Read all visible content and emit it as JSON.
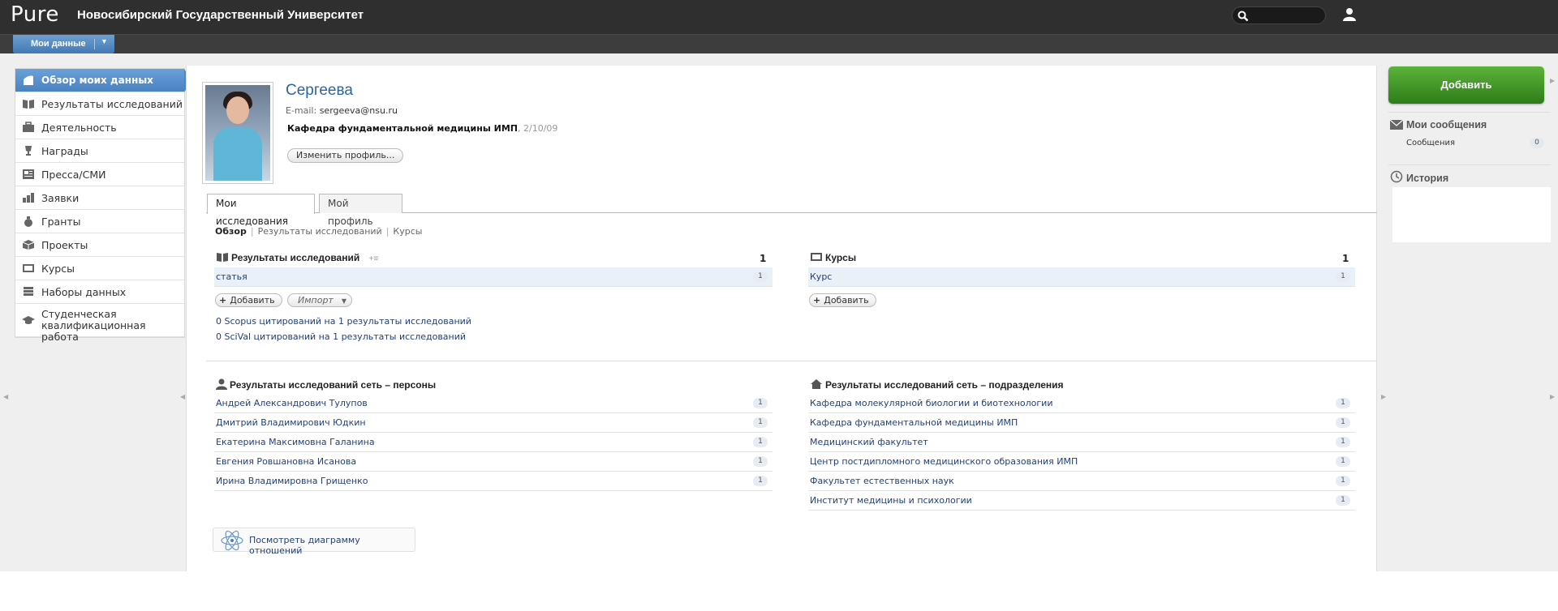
{
  "header": {
    "logo": "Pure",
    "university": "Новосибирский Государственный Университет"
  },
  "subbar": {
    "my_data_label": "Мои данные"
  },
  "nav": {
    "items": [
      {
        "label": "Обзор моих данных"
      },
      {
        "label": "Результаты исследований"
      },
      {
        "label": "Деятельность"
      },
      {
        "label": "Награды"
      },
      {
        "label": "Пресса/СМИ"
      },
      {
        "label": "Заявки"
      },
      {
        "label": "Гранты"
      },
      {
        "label": "Проекты"
      },
      {
        "label": "Курсы"
      },
      {
        "label": "Наборы данных"
      },
      {
        "label": "Студенческая квалификационная работа"
      }
    ]
  },
  "profile": {
    "name": "Сергеева",
    "email_label": "E-mail:",
    "email": "sergeeva@nsu.ru",
    "department": "Кафедра фундаментальной медицины ИМП",
    "date": ", 2/10/09",
    "edit_button": "Изменить профиль..."
  },
  "tabs": [
    {
      "label": "Мои исследования"
    },
    {
      "label": "Мой профиль"
    }
  ],
  "subnav": {
    "overview": "Обзор",
    "results": "Результаты исследований",
    "courses": "Курсы"
  },
  "research": {
    "title": "Результаты исследований",
    "count": "1",
    "rows": [
      {
        "label": "статья",
        "count": "1"
      }
    ],
    "add": "Добавить",
    "import": "Импорт",
    "scopus": "0 Scopus цитирований на 1 результаты исследований",
    "scival": "0 SciVal цитирований на 1 результаты исследований"
  },
  "courses": {
    "title": "Курсы",
    "count": "1",
    "rows": [
      {
        "label": "Курс",
        "count": "1"
      }
    ],
    "add": "Добавить"
  },
  "network_persons": {
    "title": "Результаты исследований сеть – персоны",
    "rows": [
      {
        "label": "Андрей Александрович Тулупов",
        "count": "1"
      },
      {
        "label": "Дмитрий Владимирович Юдкин",
        "count": "1"
      },
      {
        "label": "Екатерина Максимовна Галанина",
        "count": "1"
      },
      {
        "label": "Евгения Ровшановна Исанова",
        "count": "1"
      },
      {
        "label": "Ирина Владимировна Грищенко",
        "count": "1"
      }
    ]
  },
  "network_units": {
    "title": "Результаты исследований сеть – подразделения",
    "rows": [
      {
        "label": "Кафедра молекулярной биологии и биотехнологии",
        "count": "1"
      },
      {
        "label": "Кафедра фундаментальной медицины ИМП",
        "count": "1"
      },
      {
        "label": "Медицинский факультет",
        "count": "1"
      },
      {
        "label": "Центр постдипломного медицинского образования ИМП",
        "count": "1"
      },
      {
        "label": "Факультет естественных наук",
        "count": "1"
      },
      {
        "label": "Институт медицины и психологии",
        "count": "1"
      }
    ]
  },
  "graph_button": "Посмотреть диаграмму отношений",
  "right": {
    "add_button": "Добавить",
    "messages_title": "Мои сообщения",
    "messages_label": "Сообщения",
    "messages_count": "0",
    "history_title": "История"
  },
  "colors": {
    "accent_blue": "#4a82c0",
    "add_green": "#3f9a26",
    "link": "#23407a"
  }
}
